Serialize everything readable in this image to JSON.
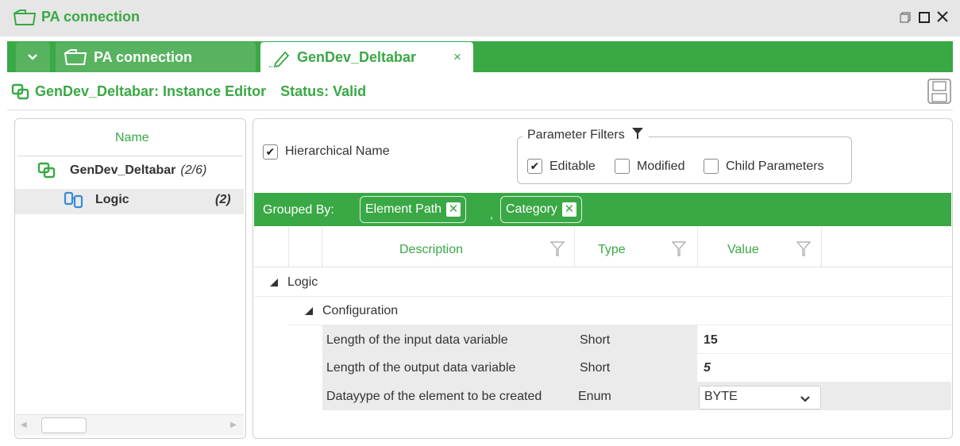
{
  "window": {
    "title": "PA connection",
    "controls": [
      "restore-icon",
      "maximize-icon",
      "close-icon"
    ]
  },
  "tabs": [
    {
      "label": "PA connection",
      "icon": "folder-icon",
      "active": false
    },
    {
      "label": "GenDev_Deltabar",
      "icon": "pencil-icon",
      "close": "×",
      "active": true
    }
  ],
  "editor": {
    "title": "GenDev_Deltabar: Instance Editor",
    "status": "Status: Valid",
    "save_icon": "save-icon"
  },
  "tree": {
    "header": "Name",
    "items": [
      {
        "label": "GenDev_Deltabar",
        "count": "(2/6)",
        "icon": "device-icon"
      },
      {
        "label": "Logic",
        "count": "(2)",
        "icon": "logic-icon",
        "selected": true
      }
    ]
  },
  "options": {
    "hierarchical_name": {
      "label": "Hierarchical Name",
      "checked": true
    }
  },
  "filters": {
    "legend": "Parameter Filters",
    "icon": "filter-icon",
    "items": [
      {
        "label": "Editable",
        "checked": true
      },
      {
        "label": "Modified",
        "checked": false
      },
      {
        "label": "Child Parameters",
        "checked": false
      }
    ]
  },
  "grouping": {
    "label": "Grouped By:",
    "chips": [
      "Element Path",
      "Category"
    ]
  },
  "grid": {
    "columns": [
      "Description",
      "Type",
      "Value"
    ],
    "groups": [
      {
        "label": "Logic",
        "subgroups": [
          {
            "label": "Configuration"
          }
        ]
      }
    ],
    "rows": [
      {
        "description": "Length of the input data variable",
        "type": "Short",
        "value": "15"
      },
      {
        "description": "Length of the output data variable",
        "type": "Short",
        "value": "5"
      },
      {
        "description": "Datayype of the element to be created",
        "type": "Enum",
        "value": "BYTE"
      }
    ]
  },
  "colors": {
    "accent": "#3aa845",
    "titlebar": "#e6e6e6",
    "tab_inactive": "#57b35f",
    "row_alt": "#ebebeb"
  }
}
